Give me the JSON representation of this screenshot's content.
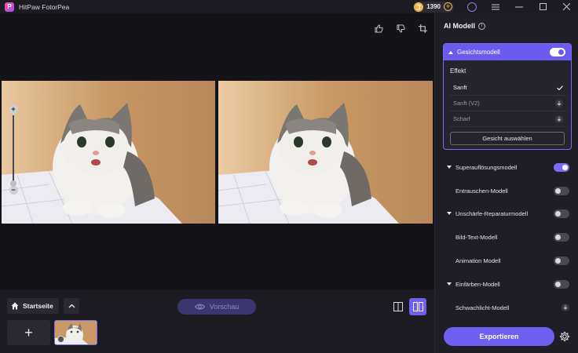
{
  "app": {
    "title": "HitPaw FotorPea",
    "logo_letter": "P"
  },
  "titlebar": {
    "coins": "1390"
  },
  "panel": {
    "title": "AI Modell",
    "face_model": {
      "label": "Gesichtsmodell",
      "enabled": true,
      "effect_heading": "Effekt",
      "effects": [
        {
          "label": "Sanft",
          "state": "selected"
        },
        {
          "label": "Sanft (V2)",
          "state": "download"
        },
        {
          "label": "Scharf",
          "state": "download"
        }
      ],
      "select_face_button": "Gesicht auswählen"
    },
    "models": [
      {
        "label": "Superauflösungsmodell",
        "group": true,
        "control": "toggle",
        "enabled": true
      },
      {
        "label": "Entrauschen-Modell",
        "group": false,
        "control": "toggle",
        "enabled": false
      },
      {
        "label": "Unschärfe-Reparaturmodell",
        "group": true,
        "control": "toggle",
        "enabled": false
      },
      {
        "label": "Bild-Text-Modell",
        "group": false,
        "control": "toggle",
        "enabled": false
      },
      {
        "label": "Animation Modell",
        "group": false,
        "control": "toggle",
        "enabled": false
      },
      {
        "label": "Einfärben-Modell",
        "group": true,
        "control": "toggle",
        "enabled": false
      },
      {
        "label": "Schwachlicht-Modell",
        "group": false,
        "control": "download",
        "enabled": false
      }
    ],
    "export_button": "Exportieren"
  },
  "bottombar": {
    "home_label": "Startseite",
    "preview_label": "Vorschau",
    "add_label": "+"
  },
  "colors": {
    "accent": "#6f5ff0",
    "background": "#141318",
    "panel": "#1f1e26"
  }
}
